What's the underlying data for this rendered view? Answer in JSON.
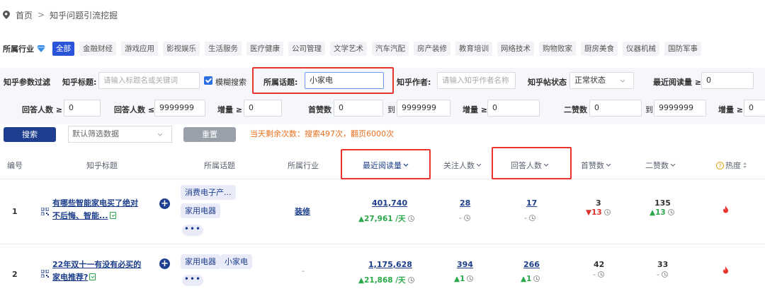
{
  "breadcrumb": {
    "home": "首页",
    "separator": ">",
    "current": "知乎问题引流挖掘"
  },
  "industry": {
    "label": "所属行业",
    "chips": [
      "全部",
      "金融财经",
      "游戏应用",
      "影视娱乐",
      "生活服务",
      "医疗健康",
      "公司管理",
      "文学艺术",
      "汽车汽配",
      "房产装修",
      "教育培训",
      "网络技术",
      "购物败家",
      "厨房美食",
      "仪器机械",
      "国防军事"
    ],
    "active_index": 0
  },
  "filters": {
    "section_label": "知乎参数过滤",
    "title_label": "知乎标题:",
    "title_placeholder": "请输入标题名或关键词",
    "fuzzy_label": "模糊搜索",
    "fuzzy_checked": true,
    "topic_label": "所属话题:",
    "topic_value": "小家电",
    "author_label": "知乎作者:",
    "author_placeholder": "请输入知乎作者名称",
    "status_label": "知乎帖状态",
    "status_value": "正常状态",
    "recent_read_label": "最近阅读量 ≥",
    "recent_read_value": "0",
    "answers_min_label": "回答人数 ≥",
    "answers_min_value": "0",
    "answers_max_label": "回答人数 ≤",
    "answers_max_value": "9999999",
    "growth_label_1": "增量 ≥",
    "growth_value_1": "0",
    "first_likes_label": "首赞数",
    "first_likes_from": "0",
    "to_label": "到",
    "first_likes_to": "9999999",
    "growth_label_2": "增量 ≥",
    "growth_value_2": "0",
    "second_likes_label": "二赞数",
    "second_likes_from": "0",
    "to_label_2": "到",
    "second_likes_to": "9999999",
    "growth_label_3": "增量 ≥",
    "growth_value_3": "0"
  },
  "actions": {
    "search": "搜索",
    "preset_select": "默认筛选数据",
    "reset": "重置",
    "remaining": "当天剩余次数：搜索497次，翻页6000次"
  },
  "table": {
    "headers": {
      "id": "编号",
      "title": "知乎标题",
      "topics": "所属话题",
      "industry": "所属行业",
      "recent_read": "最近阅读量",
      "followers": "关注人数",
      "answers": "回答人数",
      "first_likes": "首赞数",
      "second_likes": "二赞数",
      "heat": "热度"
    },
    "rows": [
      {
        "id": "1",
        "title_line1": "有哪些智能家电买了绝对",
        "title_line2": "不后悔、智能...",
        "topics": [
          "消费电子产...",
          "家用电器"
        ],
        "industry": "装修",
        "recent_read": "401,740",
        "recent_read_delta": "27,961 /天",
        "followers": "28",
        "followers_delta": "-",
        "answers": "17",
        "answers_delta": "-",
        "first_likes": "3",
        "first_likes_delta": "13",
        "second_likes": "135",
        "second_likes_delta": "13"
      },
      {
        "id": "2",
        "title_line1": "22年双十一有没有必买的",
        "title_line2": "家电推荐?",
        "topics": [
          "家用电器",
          "小家电"
        ],
        "industry": "-",
        "recent_read": "1,175,628",
        "recent_read_delta": "21,868 /天",
        "followers": "394",
        "followers_delta": "1",
        "answers": "266",
        "answers_delta": "1",
        "first_likes": "42",
        "first_likes_delta": "-",
        "second_likes": "33",
        "second_likes_delta": "-"
      }
    ]
  },
  "colors": {
    "primary": "#1e3f8f",
    "accent_red": "#e8332f",
    "up_green": "#2aa84a",
    "orange": "#e86f1e"
  }
}
